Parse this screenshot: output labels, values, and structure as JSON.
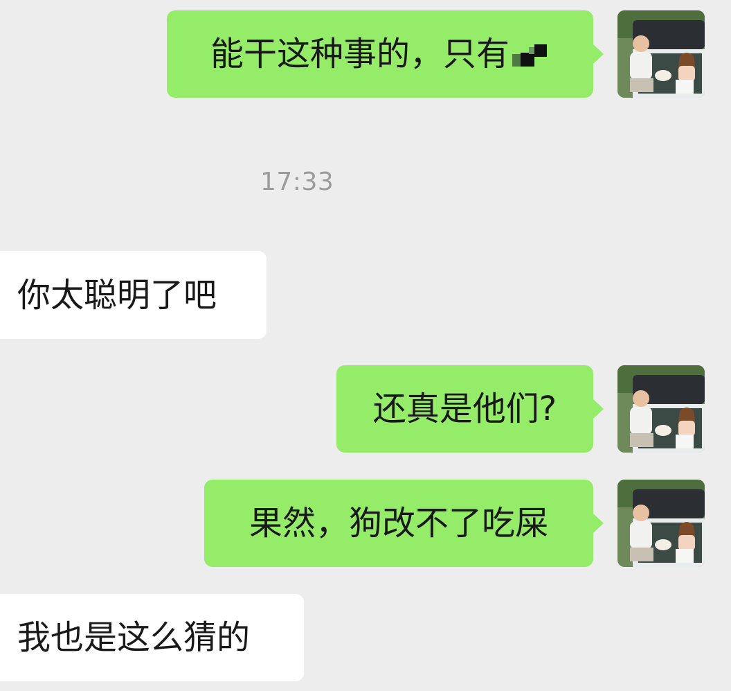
{
  "chat": {
    "messages": [
      {
        "text": "能干这种事的，只有",
        "side": "outgoing",
        "trailing_glyph": "pixelated-mosaic"
      },
      {
        "text": "你太聪明了吧",
        "side": "incoming"
      },
      {
        "text": "还真是他们?",
        "side": "outgoing"
      },
      {
        "text": "果然，狗改不了吃屎",
        "side": "outgoing"
      },
      {
        "text": "我也是这么猜的",
        "side": "incoming"
      }
    ],
    "timestamp": "17:33",
    "avatar_icon": "user-avatar-photo"
  },
  "colors": {
    "background": "#ededed",
    "outgoing_bubble": "#95ec69",
    "incoming_bubble": "#ffffff",
    "text": "#191919",
    "timestamp": "#9b9b9b"
  }
}
